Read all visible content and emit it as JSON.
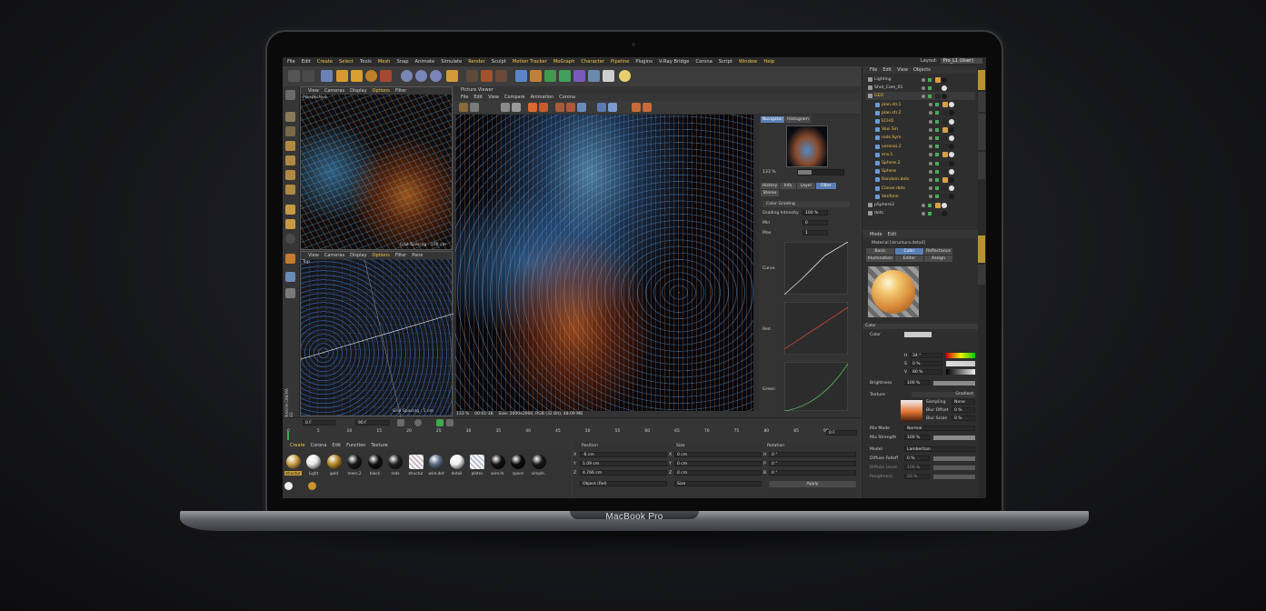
{
  "device": {
    "brand_label": "MacBook Pro"
  },
  "app": {
    "menu": [
      "File",
      "Edit",
      "Create",
      "Select",
      "Tools",
      "Mesh",
      "Snap",
      "Animate",
      "Simulate",
      "Render",
      "Sculpt",
      "Motion Tracker",
      "MoGraph",
      "Character",
      "Pipeline",
      "Plugins",
      "V-Ray Bridge",
      "Corona",
      "Script",
      "Window",
      "Help"
    ],
    "menu_highlight": [
      "Create",
      "Select",
      "Mesh",
      "Render",
      "Motion Tracker",
      "MoGraph",
      "Character",
      "Pipeline",
      "Window",
      "Help"
    ],
    "layout_label": "Layout:",
    "layout_value": "Pro_L1 (User)",
    "side_logo": "MAXON CINEMA 4D"
  },
  "viewport_top": {
    "menu": [
      "View",
      "Cameras",
      "Display",
      "Options",
      "Filter"
    ],
    "active": "Options",
    "camera_label": "Perspective",
    "grid_label": "Grid Spacing : 100 cm"
  },
  "viewport_bottom": {
    "menu": [
      "View",
      "Cameras",
      "Display",
      "Options",
      "Filter",
      "Pane"
    ],
    "active": "Options",
    "camera_label": "Top",
    "grid_label": "Grid Spacing : 1 cm"
  },
  "picture_viewer": {
    "title": "Picture Viewer",
    "menu": [
      "File",
      "Edit",
      "View",
      "Compare",
      "Animation",
      "Corona"
    ],
    "tabs": [
      "Navigator",
      "Histogram"
    ],
    "active_tab": "Navigator",
    "zoom": "133 %",
    "sub_tabs": [
      "History",
      "Info",
      "Layer",
      "Filter",
      "Stereo"
    ],
    "active_sub_tab": "Filter",
    "section": "Color Grading",
    "params": [
      {
        "label": "Grading Intensity",
        "value": "100 %"
      },
      {
        "label": "Min",
        "value": "0"
      },
      {
        "label": "Max",
        "value": "1"
      }
    ],
    "curve_labels": [
      "Curve",
      "Red",
      "Green"
    ],
    "status_zoom": "133 %",
    "status_time": "00:01:38",
    "status_info": "Size: 2000x2000, RGB (32 Bit), 48.09 MB"
  },
  "timeline": {
    "start_frame": "0 F",
    "end_frame": "90 F",
    "current_frame": "0 F",
    "ticks": [
      "0",
      "5",
      "10",
      "15",
      "20",
      "25",
      "30",
      "35",
      "40",
      "45",
      "50",
      "55",
      "60",
      "65",
      "70",
      "75",
      "80",
      "85",
      "90"
    ]
  },
  "materials": {
    "menu": [
      "Create",
      "Corona",
      "Edit",
      "Function",
      "Texture"
    ],
    "active": "Create",
    "items": [
      {
        "name": "structur",
        "color": "#c9a14a"
      },
      {
        "name": "Light",
        "color": "#e8e8e8"
      },
      {
        "name": "gold",
        "color": "#b58a2a"
      },
      {
        "name": "mess.2",
        "color": "#1a1a1a"
      },
      {
        "name": "black",
        "color": "#111111"
      },
      {
        "name": "rods",
        "color": "#202020"
      },
      {
        "name": "structur",
        "color": "#c8b8c4"
      },
      {
        "name": "wire.dot",
        "color": "#5d6f8a"
      },
      {
        "name": "detail",
        "color": "#f2f2f2"
      },
      {
        "name": "plates",
        "color": "#b8c0d0"
      },
      {
        "name": "wire.hr",
        "color": "#121212"
      },
      {
        "name": "space",
        "color": "#0d0d0d"
      },
      {
        "name": "simple.",
        "color": "#181818"
      }
    ]
  },
  "coordinates": {
    "headers": [
      "Position",
      "Size",
      "Rotation"
    ],
    "rows": [
      {
        "axis": "X",
        "pos": "-6 cm",
        "saxis": "X",
        "size": "0 cm",
        "raxis": "H",
        "rot": "0 °"
      },
      {
        "axis": "Y",
        "pos": "1.09 cm",
        "saxis": "Y",
        "size": "0 cm",
        "raxis": "P",
        "rot": "0 °"
      },
      {
        "axis": "Z",
        "pos": "4.766 cm",
        "saxis": "Z",
        "size": "0 cm",
        "raxis": "B",
        "rot": "0 °"
      }
    ],
    "mode_select": "Object (Rel)",
    "size_select": "Size",
    "apply_label": "Apply"
  },
  "object_manager": {
    "menu": [
      "File",
      "Edit",
      "View",
      "Objects"
    ],
    "objects": [
      {
        "name": "Lighting",
        "color": "#cfcfcf"
      },
      {
        "name": "Shot_Cam_01",
        "color": "#cfcfcf"
      },
      {
        "name": "GEO",
        "color": "#f2c54a"
      },
      {
        "name": "plan.str.1",
        "color": "#f2c54a"
      },
      {
        "name": "plan.str.2",
        "color": "#f2c54a"
      },
      {
        "name": "ECHO",
        "color": "#f2c54a"
      },
      {
        "name": "Voxi.Sin",
        "color": "#f2c54a"
      },
      {
        "name": "rods.Sym",
        "color": "#f2c54a"
      },
      {
        "name": "voronoi.2",
        "color": "#f2c54a"
      },
      {
        "name": "env.1",
        "color": "#f2c54a"
      },
      {
        "name": "Sphere.2",
        "color": "#f2c54a"
      },
      {
        "name": "Sphere",
        "color": "#f2c54a"
      },
      {
        "name": "Random.dots",
        "color": "#f2c54a"
      },
      {
        "name": "Cloner.dots",
        "color": "#f2c54a"
      },
      {
        "name": "Vonfone",
        "color": "#f2c54a"
      },
      {
        "name": "pSphere2",
        "color": "#cfcfcf"
      },
      {
        "name": "dots",
        "color": "#cfcfcf"
      }
    ]
  },
  "attributes": {
    "menu": [
      "Mode",
      "Edit"
    ],
    "title": "Material [structura.detail]",
    "tabs": [
      "Basic",
      "Color",
      "Reflectance",
      "Illumination",
      "Editor",
      "Assign"
    ],
    "active_tab": "Color",
    "section": "Color",
    "color_label": "Color",
    "hsv": [
      {
        "label": "H",
        "value": "34 °"
      },
      {
        "label": "S",
        "value": "0 %"
      },
      {
        "label": "V",
        "value": "80 %"
      }
    ],
    "brightness_label": "Brightness",
    "brightness_value": "100 %",
    "texture_label": "Texture",
    "texture_value": "Gradient",
    "sampling_label": "Sampling",
    "sampling_value": "None",
    "blur_offset_label": "Blur Offset",
    "blur_offset_value": "0 %",
    "blur_scale_label": "Blur Scale",
    "blur_scale_value": "0 %",
    "mix_mode_label": "Mix Mode",
    "mix_mode_value": "Normal",
    "mix_strength_label": "Mix Strength",
    "mix_strength_value": "100 %",
    "model_label": "Model",
    "model_value": "Lambertian",
    "diffuse_falloff_label": "Diffuse Falloff",
    "diffuse_falloff_value": "0 %",
    "diffuse_level_label": "Diffuse Level",
    "diffuse_level_value": "100 %",
    "roughness_label": "Roughness",
    "roughness_value": "50 %"
  }
}
